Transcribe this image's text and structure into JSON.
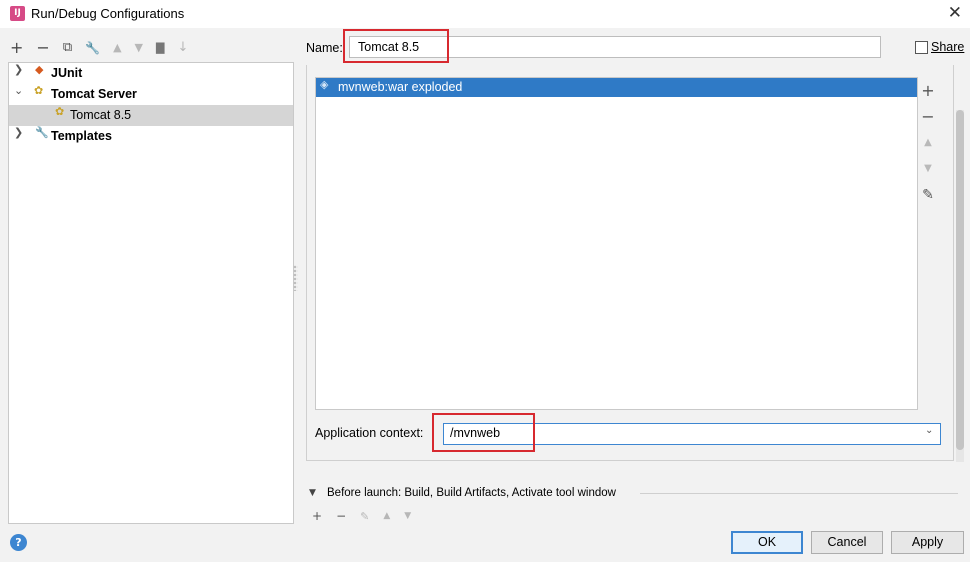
{
  "window": {
    "title": "Run/Debug Configurations",
    "app_icon_text": "IJ",
    "close_icon": "close-icon"
  },
  "left_toolbar": {
    "buttons": [
      {
        "icon": "add-icon",
        "glyph": "+"
      },
      {
        "icon": "remove-icon",
        "glyph": "−"
      },
      {
        "icon": "copy-icon",
        "glyph": "⧉"
      },
      {
        "icon": "wrench-icon",
        "glyph": "🔧"
      },
      {
        "icon": "move-up-icon",
        "glyph": "▲"
      },
      {
        "icon": "move-down-icon",
        "glyph": "▼"
      },
      {
        "icon": "new-folder-icon",
        "glyph": "▇"
      },
      {
        "icon": "sort-icon",
        "glyph": "↓"
      }
    ]
  },
  "tree": {
    "items": [
      {
        "label": "JUnit",
        "icon": "junit-icon",
        "expanded": false
      },
      {
        "label": "Tomcat Server",
        "icon": "tomcat-icon",
        "expanded": true
      },
      {
        "label": "Tomcat 8.5",
        "icon": "tomcat-icon",
        "selected": true
      },
      {
        "label": "Templates",
        "icon": "wrench-icon",
        "expanded": false
      }
    ]
  },
  "config": {
    "name_label": "Name:",
    "name_value": "Tomcat 8.5",
    "share_label": "Share",
    "share_checked": false
  },
  "deployment": {
    "items": [
      {
        "label": "mvnweb:war exploded",
        "icon": "artifact-icon",
        "selected": true
      }
    ],
    "side_buttons": [
      {
        "icon": "add-icon",
        "glyph": "+"
      },
      {
        "icon": "remove-icon",
        "glyph": "−"
      },
      {
        "icon": "move-up-icon",
        "glyph": "▲"
      },
      {
        "icon": "move-down-icon",
        "glyph": "▼"
      },
      {
        "icon": "edit-pencil-icon",
        "glyph": "✎"
      }
    ]
  },
  "app_context": {
    "label": "Application context:",
    "value": "/mvnweb"
  },
  "before_launch": {
    "label": "Before launch: Build, Build Artifacts, Activate tool window",
    "buttons": [
      {
        "icon": "add-icon",
        "glyph": "+"
      },
      {
        "icon": "remove-icon",
        "glyph": "−"
      },
      {
        "icon": "edit-pencil-icon",
        "glyph": "✎"
      },
      {
        "icon": "move-up-icon",
        "glyph": "▲"
      },
      {
        "icon": "move-down-icon",
        "glyph": "▼"
      }
    ]
  },
  "footer": {
    "help_glyph": "?",
    "ok": "OK",
    "cancel": "Cancel",
    "apply": "Apply"
  },
  "colors": {
    "selection_blue": "#2f7ac6",
    "focus_blue": "#3d86d1",
    "highlight_red": "#d7292f",
    "dialog_bg": "#f2f2f2"
  }
}
